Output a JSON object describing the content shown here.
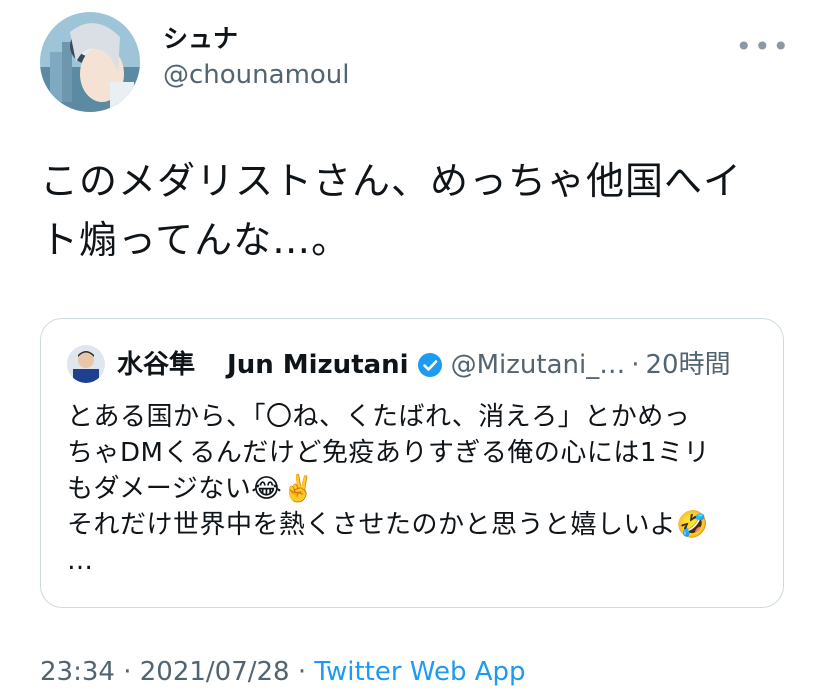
{
  "author": {
    "name": "シュナ",
    "handle": "@chounamoul"
  },
  "more_icon": "more-dots-icon",
  "tweet": {
    "text": "このメダリストさん、めっちゃ他国へイ\nト煽ってんな…。"
  },
  "quote": {
    "name": "水谷隼",
    "display_name": "Jun Mizutani",
    "verified_icon": "verified-badge-icon",
    "handle": "@Mizutani_…",
    "separator": "·",
    "time": "20時間",
    "text": "とある国から、「〇ね、くたばれ、消えろ」とかめっ\nちゃDMくるんだけど免疫ありすぎる俺の心には1ミリ\nもダメージない😂✌️\nそれだけ世界中を熱くさせたのかと思うと嬉しいよ🤣\n…"
  },
  "footer": {
    "time": "23:34",
    "sep1": "·",
    "date": "2021/07/28",
    "sep2": "·",
    "source": "Twitter Web App"
  },
  "colors": {
    "secondary_text": "#536471",
    "link": "#1d9bf0",
    "border": "#cfd9de"
  }
}
